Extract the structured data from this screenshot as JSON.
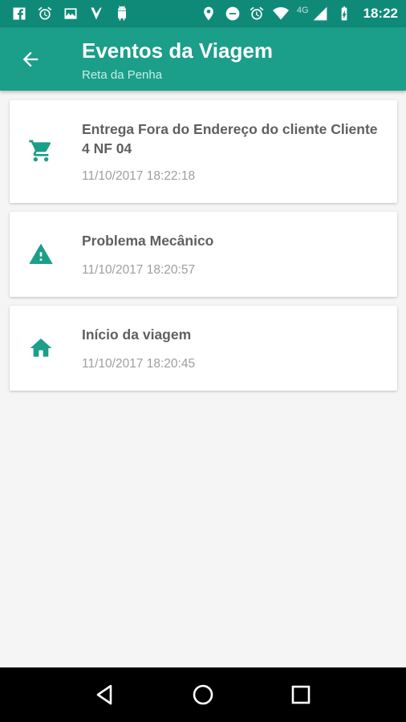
{
  "status_bar": {
    "network": "4G",
    "time": "18:22"
  },
  "app_bar": {
    "title": "Eventos da Viagem",
    "subtitle": "Reta da Penha",
    "back_icon": "arrow-back-icon"
  },
  "events": [
    {
      "icon": "shopping-cart-icon",
      "title": "Entrega Fora do Endereço do cliente Cliente 4 NF 04",
      "time": "11/10/2017 18:22:18"
    },
    {
      "icon": "warning-icon",
      "title": "Problema Mecânico",
      "time": "11/10/2017 18:20:57"
    },
    {
      "icon": "home-icon",
      "title": "Início da viagem",
      "time": "11/10/2017 18:20:45"
    }
  ],
  "colors": {
    "primary": "#1b9e8a",
    "primary_dark": "#0f8a79",
    "background": "#f5f5f5"
  }
}
